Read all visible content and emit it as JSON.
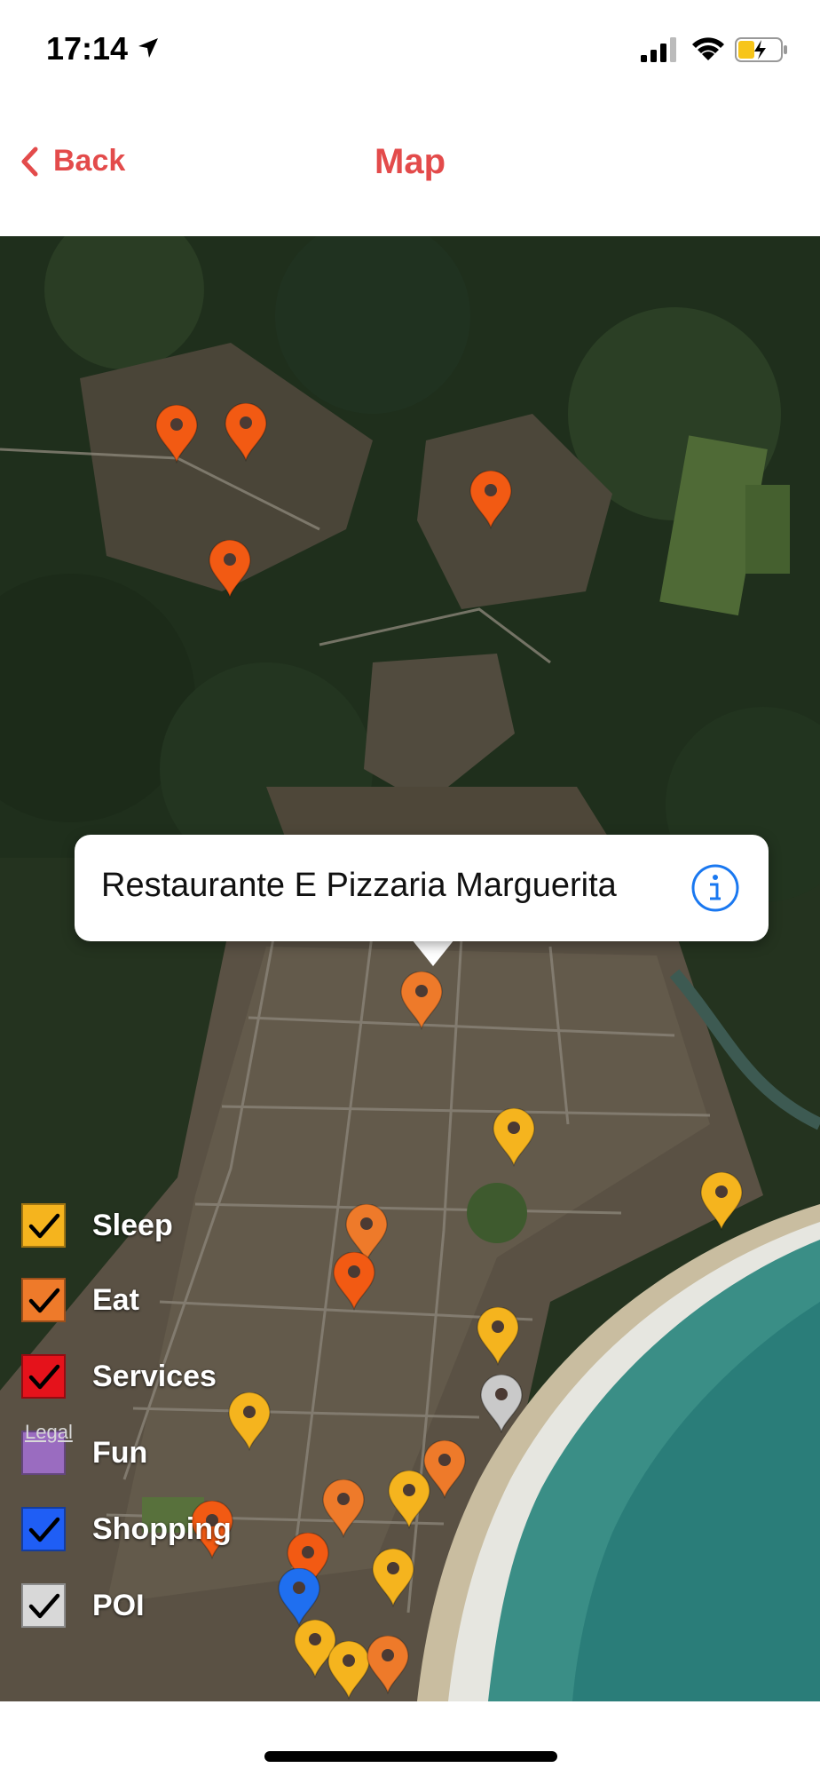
{
  "status_bar": {
    "time": "17:14"
  },
  "nav": {
    "back_label": "Back",
    "title": "Map"
  },
  "callout": {
    "title": "Restaurante E Pizzaria Marguerita"
  },
  "legend": [
    {
      "label": "Sleep",
      "color": "#f5b41e",
      "checked": true
    },
    {
      "label": "Eat",
      "color": "#ee7a2a",
      "checked": true
    },
    {
      "label": "Services",
      "color": "#e5121b",
      "checked": true
    },
    {
      "label": "Fun",
      "color": "#9a6cc0",
      "checked": false
    },
    {
      "label": "Shopping",
      "color": "#1f5ef5",
      "checked": true
    },
    {
      "label": "POI",
      "color": "#d8d8d8",
      "checked": true
    }
  ],
  "map": {
    "legal_label": "Legal"
  },
  "colors": {
    "accent": "#e34b4b",
    "pin_eat": "#ee7a2a",
    "pin_services": "#f25a13",
    "pin_sleep": "#f5b41e",
    "pin_shopping": "#1f6ff0",
    "pin_poi": "#c9c9c9",
    "info": "#1a78f0"
  }
}
